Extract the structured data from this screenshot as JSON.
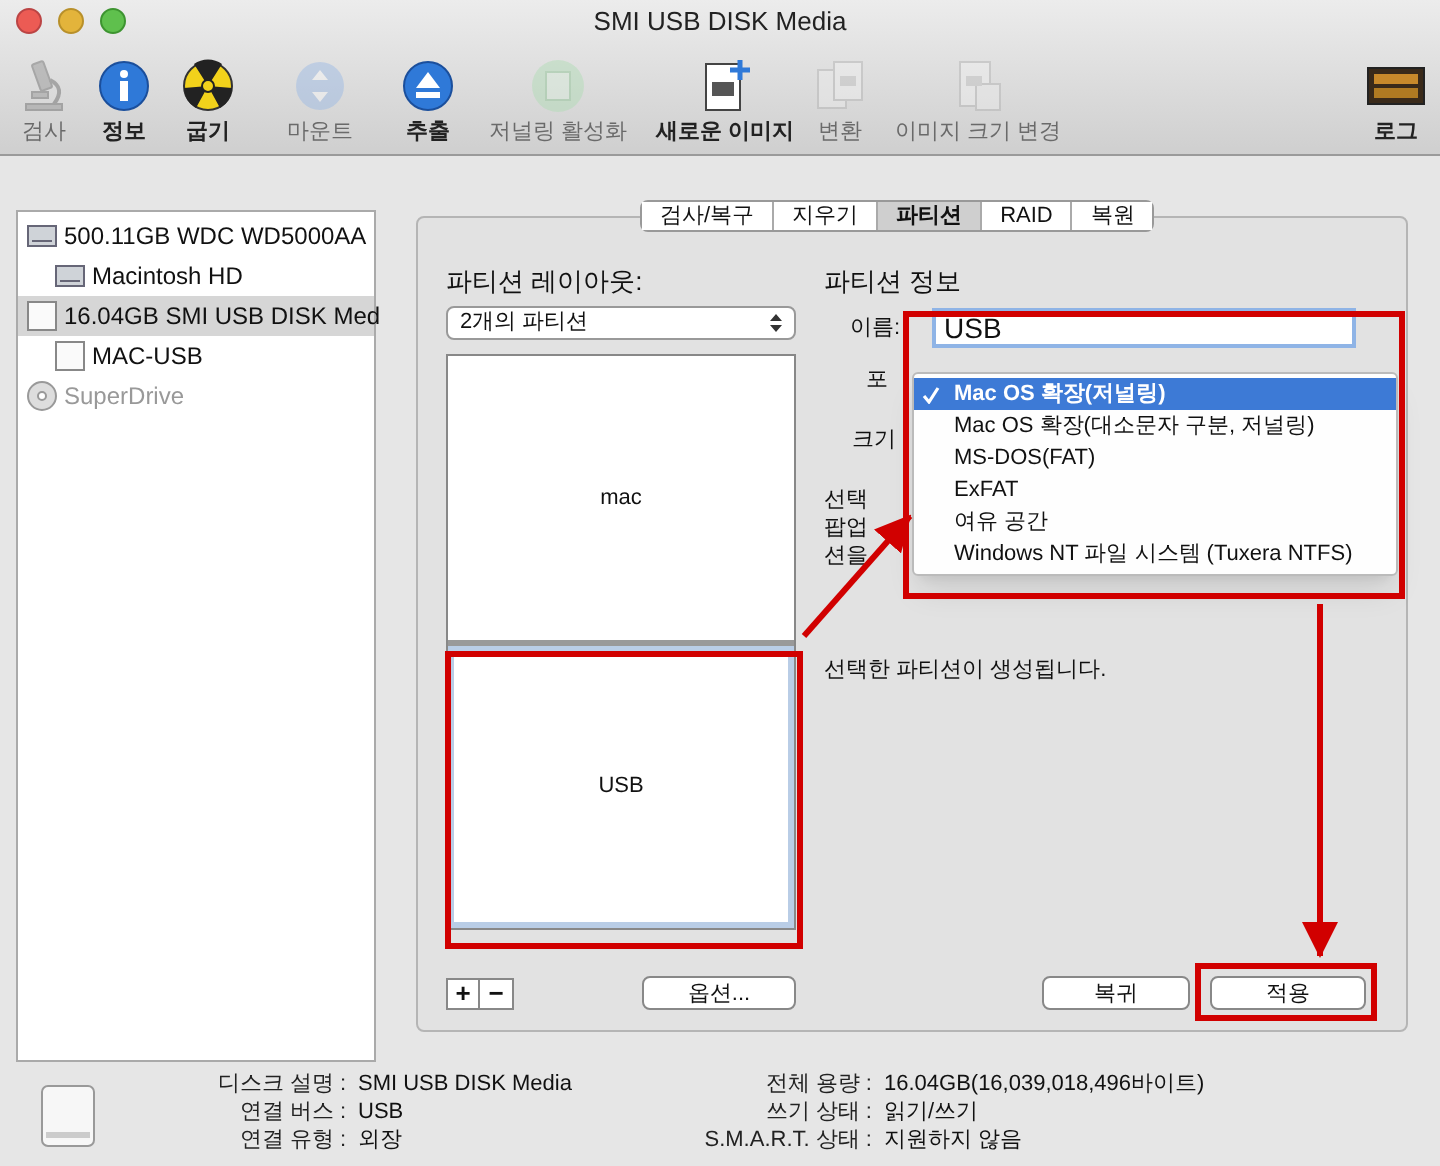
{
  "window": {
    "title": "SMI USB DISK Media"
  },
  "toolbar": [
    {
      "label": "검사",
      "kind": "microscope",
      "disabled": true
    },
    {
      "label": "정보",
      "kind": "info",
      "disabled": false
    },
    {
      "label": "굽기",
      "kind": "burn",
      "disabled": false
    },
    {
      "label": "마운트",
      "kind": "mount",
      "disabled": true
    },
    {
      "label": "추출",
      "kind": "eject",
      "disabled": false
    },
    {
      "label": "저널링 활성화",
      "kind": "journal",
      "disabled": true
    },
    {
      "label": "새로운 이미지",
      "kind": "newimage",
      "disabled": false
    },
    {
      "label": "변환",
      "kind": "convert",
      "disabled": true
    },
    {
      "label": "이미지 크기 변경",
      "kind": "resize",
      "disabled": true
    },
    {
      "label": "로그",
      "kind": "log",
      "disabled": false
    }
  ],
  "sidebar": {
    "items": [
      {
        "label": "500.11GB WDC WD5000AA",
        "kind": "hdd",
        "selected": false,
        "disabled": false,
        "children": [
          {
            "label": "Macintosh HD",
            "kind": "hdd",
            "selected": false,
            "disabled": false
          }
        ]
      },
      {
        "label": "16.04GB SMI USB DISK Med",
        "kind": "usb",
        "selected": true,
        "disabled": false,
        "children": [
          {
            "label": "MAC-USB",
            "kind": "usb",
            "selected": false,
            "disabled": false
          }
        ]
      },
      {
        "label": "SuperDrive",
        "kind": "optical",
        "selected": false,
        "disabled": true
      }
    ]
  },
  "tabs": [
    {
      "label": "검사/복구",
      "selected": false
    },
    {
      "label": "지우기",
      "selected": false
    },
    {
      "label": "파티션",
      "selected": true
    },
    {
      "label": "RAID",
      "selected": false
    },
    {
      "label": "복원",
      "selected": false
    }
  ],
  "partition_layout": {
    "title": "파티션 레이아웃:",
    "scheme": "2개의 파티션",
    "partitions": [
      {
        "name": "mac",
        "selected": false
      },
      {
        "name": "USB",
        "selected": true
      }
    ],
    "add": "+",
    "remove": "−",
    "options_button": "옵션..."
  },
  "partition_info": {
    "title": "파티션 정보",
    "name_label": "이름:",
    "name_value": "USB",
    "format_label": "포",
    "size_label": "크기",
    "description_fragments": [
      "선택",
      "팝업",
      "션을"
    ],
    "note": "선택한 파티션이 생성됩니다.",
    "revert_button": "복귀",
    "apply_button": "적용",
    "format_menu": [
      {
        "label": "Mac OS 확장(저널링)",
        "selected": true
      },
      {
        "label": "Mac OS 확장(대소문자 구분, 저널링)",
        "selected": false
      },
      {
        "label": "MS-DOS(FAT)",
        "selected": false
      },
      {
        "label": "ExFAT",
        "selected": false
      },
      {
        "label": "여유 공간",
        "selected": false
      },
      {
        "label": "Windows NT 파일 시스템 (Tuxera NTFS)",
        "selected": false
      }
    ]
  },
  "disk_info": {
    "left": [
      {
        "label": "디스크 설명 :",
        "value": "SMI USB DISK Media"
      },
      {
        "label": "연결 버스 :",
        "value": "USB"
      },
      {
        "label": "연결 유형 :",
        "value": "외장"
      }
    ],
    "right": [
      {
        "label": "전체 용량 :",
        "value": "16.04GB(16,039,018,496바이트)"
      },
      {
        "label": "쓰기 상태 :",
        "value": "읽기/쓰기"
      },
      {
        "label": "S.M.A.R.T. 상태 :",
        "value": "지원하지 않음"
      }
    ]
  }
}
